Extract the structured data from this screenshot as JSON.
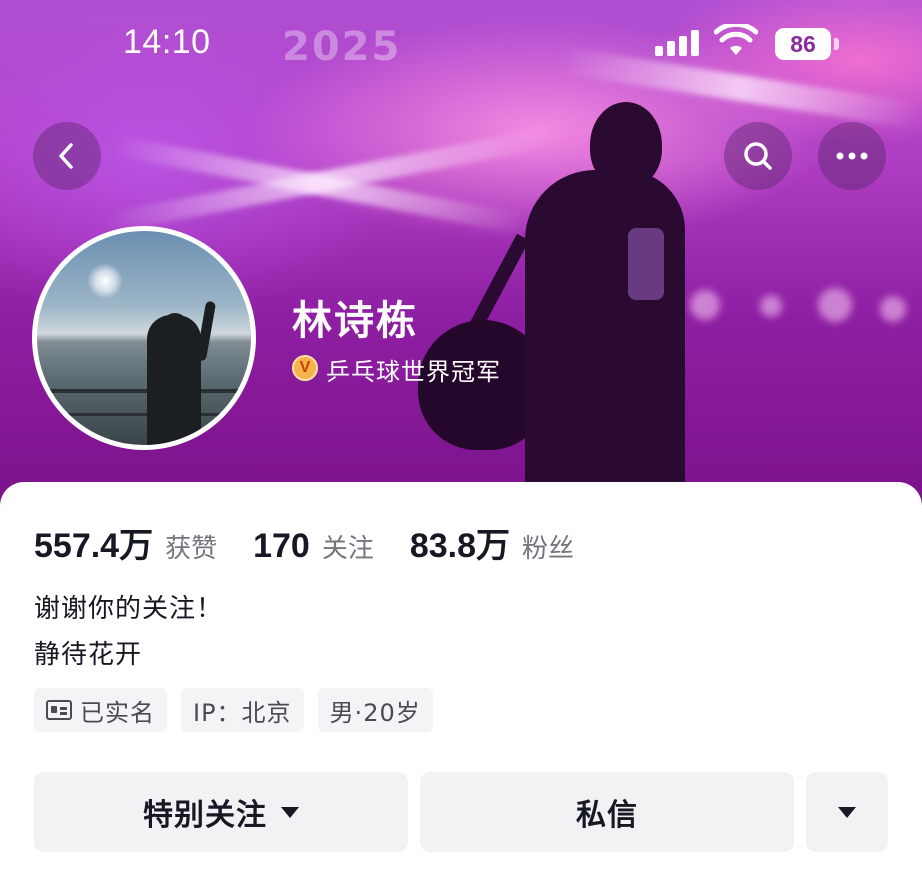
{
  "status_bar": {
    "time": "14:10",
    "battery": "86"
  },
  "banner": {
    "background_text": "2025",
    "accent_color": "#b03ec4"
  },
  "nav": {
    "back_icon": "chevron-left-icon",
    "search_icon": "search-icon",
    "more_icon": "more-horizontal-icon"
  },
  "profile": {
    "name": "林诗栋",
    "verify_badge": "V",
    "verify_title": "乒乓球世界冠军"
  },
  "stats": [
    {
      "value": "557.4万",
      "label": "获赞"
    },
    {
      "value": "170",
      "label": "关注"
    },
    {
      "value": "83.8万",
      "label": "粉丝"
    }
  ],
  "bio": {
    "line1": "谢谢你的关注！",
    "line2": "静待花开"
  },
  "tags": {
    "verified": "已实名",
    "ip": "IP：北京",
    "gender_age": "男·20岁"
  },
  "actions": {
    "follow": "特别关注",
    "message": "私信"
  }
}
